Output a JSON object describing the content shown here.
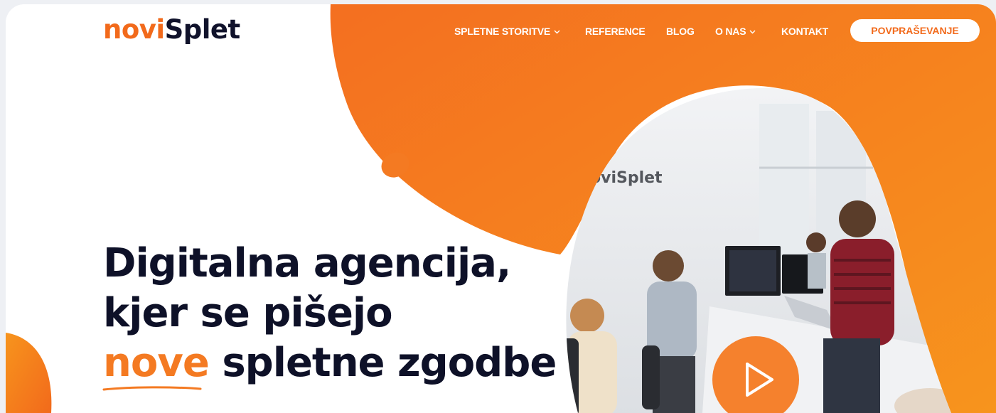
{
  "brand": {
    "logo_part1": "novi",
    "logo_part2": "Splet",
    "accent_color": "#f26a1b",
    "dark_color": "#0e1128"
  },
  "nav": {
    "items": [
      {
        "label": "SPLETNE STORITVE",
        "has_dropdown": true
      },
      {
        "label": "REFERENCE",
        "has_dropdown": false
      },
      {
        "label": "BLOG",
        "has_dropdown": false
      },
      {
        "label": "O NAS",
        "has_dropdown": true
      },
      {
        "label": "KONTAKT",
        "has_dropdown": false
      }
    ],
    "cta_label": "POVPRAŠEVANJE"
  },
  "hero": {
    "line1": "Digitalna agencija,",
    "line2": "kjer se pišejo",
    "line3_highlight": "nove",
    "line3_rest": " spletne zgodbe"
  },
  "media": {
    "photo_sign": "oviSplet",
    "play_icon": "play-icon"
  }
}
